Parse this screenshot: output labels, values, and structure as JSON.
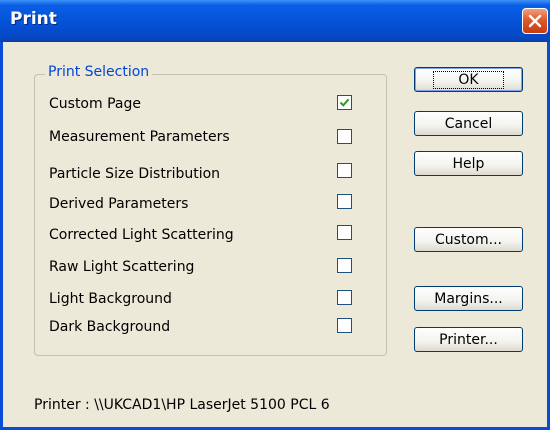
{
  "window": {
    "title": "Print"
  },
  "group": {
    "legend": "Print Selection",
    "items": [
      {
        "label": "Custom Page",
        "checked": true
      },
      {
        "label": "Measurement Parameters",
        "checked": false
      },
      {
        "label": "Particle Size Distribution",
        "checked": false
      },
      {
        "label": "Derived Parameters",
        "checked": false
      },
      {
        "label": "Corrected Light Scattering",
        "checked": false
      },
      {
        "label": "Raw Light Scattering",
        "checked": false
      },
      {
        "label": "Light Background",
        "checked": false
      },
      {
        "label": "Dark Background",
        "checked": false
      }
    ]
  },
  "buttons": {
    "ok": "OK",
    "cancel": "Cancel",
    "help": "Help",
    "custom": "Custom...",
    "margins": "Margins...",
    "printer": "Printer..."
  },
  "status": {
    "printer": "Printer : \\\\UKCAD1\\HP LaserJet 5100 PCL 6"
  },
  "colors": {
    "title_bar": "#0553d8",
    "legend_text": "#0046d5",
    "check": "#21a121",
    "close": "#e05a2a"
  },
  "icons": {
    "close": "close-icon",
    "check": "checkmark-icon"
  }
}
